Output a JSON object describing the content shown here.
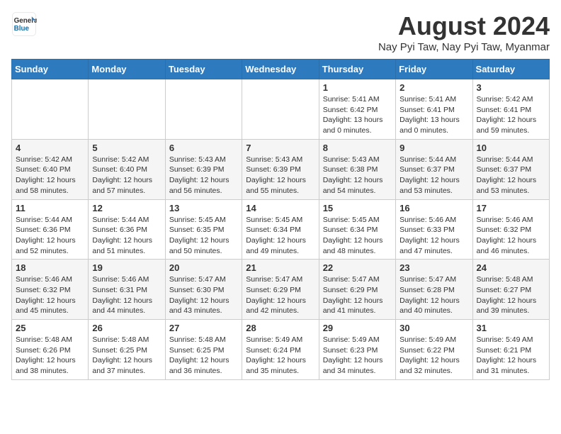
{
  "header": {
    "logo_general": "General",
    "logo_blue": "Blue",
    "title": "August 2024",
    "subtitle": "Nay Pyi Taw, Nay Pyi Taw, Myanmar"
  },
  "days_of_week": [
    "Sunday",
    "Monday",
    "Tuesday",
    "Wednesday",
    "Thursday",
    "Friday",
    "Saturday"
  ],
  "weeks": [
    [
      {
        "day": "",
        "info": ""
      },
      {
        "day": "",
        "info": ""
      },
      {
        "day": "",
        "info": ""
      },
      {
        "day": "",
        "info": ""
      },
      {
        "day": "1",
        "info": "Sunrise: 5:41 AM\nSunset: 6:42 PM\nDaylight: 13 hours\nand 0 minutes."
      },
      {
        "day": "2",
        "info": "Sunrise: 5:41 AM\nSunset: 6:41 PM\nDaylight: 13 hours\nand 0 minutes."
      },
      {
        "day": "3",
        "info": "Sunrise: 5:42 AM\nSunset: 6:41 PM\nDaylight: 12 hours\nand 59 minutes."
      }
    ],
    [
      {
        "day": "4",
        "info": "Sunrise: 5:42 AM\nSunset: 6:40 PM\nDaylight: 12 hours\nand 58 minutes."
      },
      {
        "day": "5",
        "info": "Sunrise: 5:42 AM\nSunset: 6:40 PM\nDaylight: 12 hours\nand 57 minutes."
      },
      {
        "day": "6",
        "info": "Sunrise: 5:43 AM\nSunset: 6:39 PM\nDaylight: 12 hours\nand 56 minutes."
      },
      {
        "day": "7",
        "info": "Sunrise: 5:43 AM\nSunset: 6:39 PM\nDaylight: 12 hours\nand 55 minutes."
      },
      {
        "day": "8",
        "info": "Sunrise: 5:43 AM\nSunset: 6:38 PM\nDaylight: 12 hours\nand 54 minutes."
      },
      {
        "day": "9",
        "info": "Sunrise: 5:44 AM\nSunset: 6:37 PM\nDaylight: 12 hours\nand 53 minutes."
      },
      {
        "day": "10",
        "info": "Sunrise: 5:44 AM\nSunset: 6:37 PM\nDaylight: 12 hours\nand 53 minutes."
      }
    ],
    [
      {
        "day": "11",
        "info": "Sunrise: 5:44 AM\nSunset: 6:36 PM\nDaylight: 12 hours\nand 52 minutes."
      },
      {
        "day": "12",
        "info": "Sunrise: 5:44 AM\nSunset: 6:36 PM\nDaylight: 12 hours\nand 51 minutes."
      },
      {
        "day": "13",
        "info": "Sunrise: 5:45 AM\nSunset: 6:35 PM\nDaylight: 12 hours\nand 50 minutes."
      },
      {
        "day": "14",
        "info": "Sunrise: 5:45 AM\nSunset: 6:34 PM\nDaylight: 12 hours\nand 49 minutes."
      },
      {
        "day": "15",
        "info": "Sunrise: 5:45 AM\nSunset: 6:34 PM\nDaylight: 12 hours\nand 48 minutes."
      },
      {
        "day": "16",
        "info": "Sunrise: 5:46 AM\nSunset: 6:33 PM\nDaylight: 12 hours\nand 47 minutes."
      },
      {
        "day": "17",
        "info": "Sunrise: 5:46 AM\nSunset: 6:32 PM\nDaylight: 12 hours\nand 46 minutes."
      }
    ],
    [
      {
        "day": "18",
        "info": "Sunrise: 5:46 AM\nSunset: 6:32 PM\nDaylight: 12 hours\nand 45 minutes."
      },
      {
        "day": "19",
        "info": "Sunrise: 5:46 AM\nSunset: 6:31 PM\nDaylight: 12 hours\nand 44 minutes."
      },
      {
        "day": "20",
        "info": "Sunrise: 5:47 AM\nSunset: 6:30 PM\nDaylight: 12 hours\nand 43 minutes."
      },
      {
        "day": "21",
        "info": "Sunrise: 5:47 AM\nSunset: 6:29 PM\nDaylight: 12 hours\nand 42 minutes."
      },
      {
        "day": "22",
        "info": "Sunrise: 5:47 AM\nSunset: 6:29 PM\nDaylight: 12 hours\nand 41 minutes."
      },
      {
        "day": "23",
        "info": "Sunrise: 5:47 AM\nSunset: 6:28 PM\nDaylight: 12 hours\nand 40 minutes."
      },
      {
        "day": "24",
        "info": "Sunrise: 5:48 AM\nSunset: 6:27 PM\nDaylight: 12 hours\nand 39 minutes."
      }
    ],
    [
      {
        "day": "25",
        "info": "Sunrise: 5:48 AM\nSunset: 6:26 PM\nDaylight: 12 hours\nand 38 minutes."
      },
      {
        "day": "26",
        "info": "Sunrise: 5:48 AM\nSunset: 6:25 PM\nDaylight: 12 hours\nand 37 minutes."
      },
      {
        "day": "27",
        "info": "Sunrise: 5:48 AM\nSunset: 6:25 PM\nDaylight: 12 hours\nand 36 minutes."
      },
      {
        "day": "28",
        "info": "Sunrise: 5:49 AM\nSunset: 6:24 PM\nDaylight: 12 hours\nand 35 minutes."
      },
      {
        "day": "29",
        "info": "Sunrise: 5:49 AM\nSunset: 6:23 PM\nDaylight: 12 hours\nand 34 minutes."
      },
      {
        "day": "30",
        "info": "Sunrise: 5:49 AM\nSunset: 6:22 PM\nDaylight: 12 hours\nand 32 minutes."
      },
      {
        "day": "31",
        "info": "Sunrise: 5:49 AM\nSunset: 6:21 PM\nDaylight: 12 hours\nand 31 minutes."
      }
    ]
  ]
}
